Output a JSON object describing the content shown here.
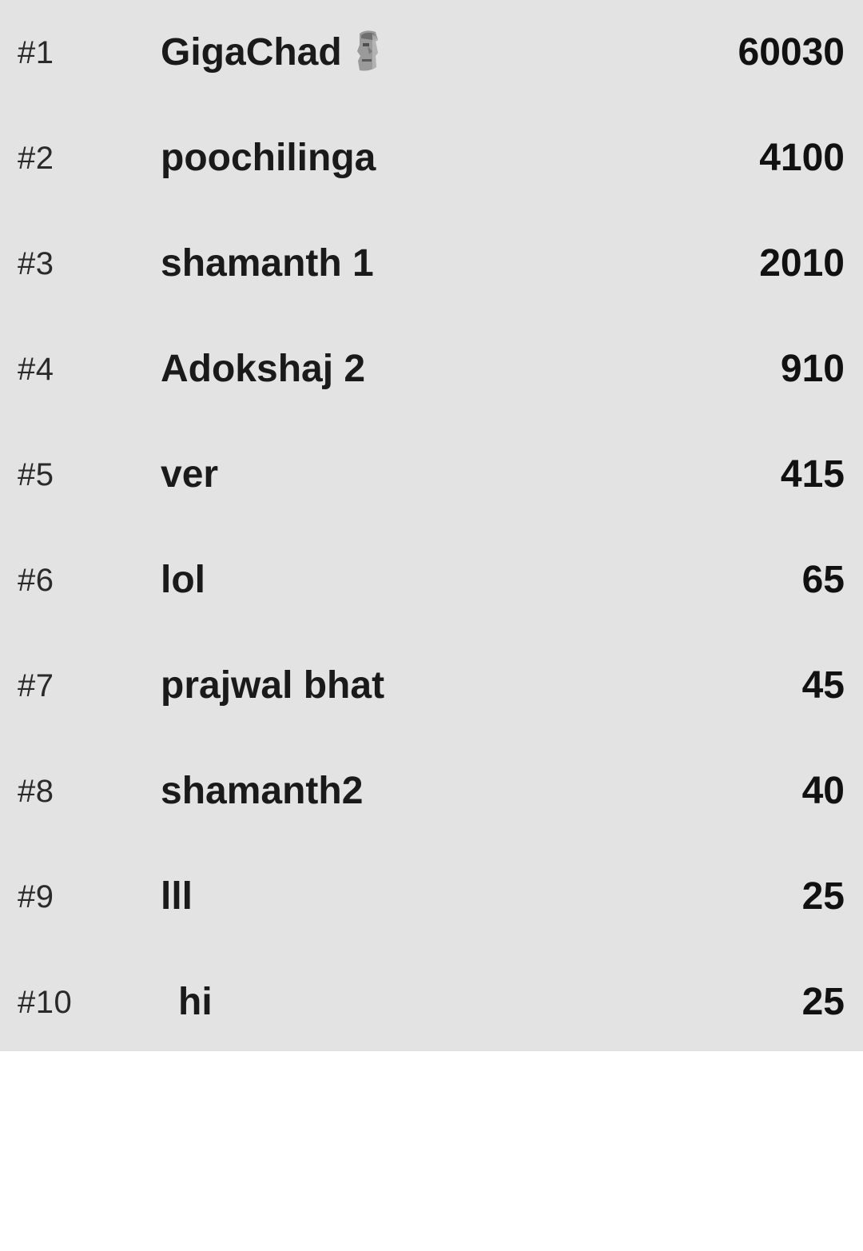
{
  "leaderboard": {
    "rows": [
      {
        "rank": "#1",
        "name": "GigaChad",
        "icon": "moai-icon",
        "score": "60030"
      },
      {
        "rank": "#2",
        "name": "poochilinga",
        "score": "4100"
      },
      {
        "rank": "#3",
        "name": "shamanth 1",
        "score": "2010"
      },
      {
        "rank": "#4",
        "name": "Adokshaj 2",
        "score": "910"
      },
      {
        "rank": "#5",
        "name": "ver",
        "score": "415"
      },
      {
        "rank": "#6",
        "name": "lol",
        "score": "65"
      },
      {
        "rank": "#7",
        "name": "prajwal bhat",
        "score": "45"
      },
      {
        "rank": "#8",
        "name": "shamanth2",
        "score": "40"
      },
      {
        "rank": "#9",
        "name": "lll",
        "score": "25"
      },
      {
        "rank": "#10",
        "name": "hi",
        "score": "25"
      }
    ]
  },
  "colors": {
    "list_background": "#e3e3e3",
    "page_background": "#ffffff",
    "text_primary": "#1a1a1a"
  }
}
